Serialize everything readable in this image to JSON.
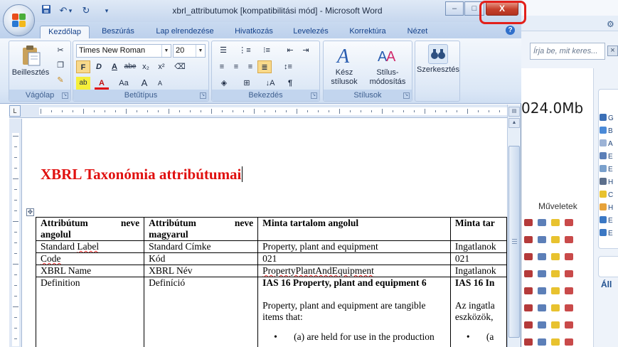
{
  "window": {
    "title": "xbrl_attributumok [kompatibilitási mód] - Microsoft Word",
    "minimize_label": "–",
    "maximize_label": "□",
    "close_label": "X"
  },
  "qat": {
    "undo_dropdown": "▾",
    "customize": "▾"
  },
  "tabs": [
    "Kezdőlap",
    "Beszúrás",
    "Lap elrendezése",
    "Hivatkozás",
    "Levelezés",
    "Korrektúra",
    "Nézet"
  ],
  "ribbon": {
    "clipboard": {
      "group": "Vágólap",
      "paste": "Beillesztés"
    },
    "font": {
      "group": "Betűtípus",
      "font_name": "Times New Roman",
      "font_size": "20",
      "bold": "F",
      "italic": "D",
      "underline": "A",
      "strike": "abe",
      "subscript": "x₂",
      "superscript": "x²",
      "case": "Aa",
      "grow": "A",
      "shrink": "A"
    },
    "paragraph": {
      "group": "Bekezdés",
      "pilcrow": "¶"
    },
    "styles": {
      "group": "Stílusok",
      "quick": "Kész stílusok",
      "change": "Stílus-módosítás"
    },
    "editing": {
      "label": "Szerkesztés"
    }
  },
  "document": {
    "title": "XBRL Taxonómia attribútumai",
    "table": {
      "headers": [
        {
          "a": "Attribútum",
          "b": "neve",
          "c": "angolul"
        },
        {
          "a": "Attribútum",
          "b": "neve",
          "c": "magyarul"
        },
        {
          "a": "Minta tartalom angolul",
          "b": "",
          "c": ""
        },
        {
          "a": "Minta tar",
          "b": "",
          "c": ""
        }
      ],
      "rows": [
        [
          "Standard Label",
          "Standard Címke",
          "Property, plant and equipment",
          "Ingatlanok"
        ],
        [
          "Code",
          "Kód",
          "021",
          "021"
        ],
        [
          "XBRL Name",
          "XBRL Név",
          "PropertyPlantAndEquipment",
          "Ingatlanok"
        ],
        [
          "Definition",
          "Definíció",
          "IAS 16 Property, plant and equipment 6",
          "IAS 16 In"
        ]
      ],
      "definition_para": "Property, plant and equipment are tangible items that:",
      "definition_bullet": "(a) are held for use in the production",
      "definition_para_hu": "Az ingatla eszközök,",
      "definition_bullet_hu": "(a"
    }
  },
  "background_app": {
    "search_placeholder": "Írja be, mit keres...",
    "search_close": "×",
    "size_text": "024.0Mb",
    "actions_label": "Műveletek",
    "all_label": "Áll",
    "side_items": [
      "G",
      "B",
      "A",
      "E",
      "E",
      "H",
      "C",
      "H",
      "E",
      "E"
    ]
  },
  "colors": {
    "title_red": "#e0100f",
    "ribbon_text": "#15428b",
    "close_button": "#c6402c",
    "highlight": "#e2201b"
  }
}
